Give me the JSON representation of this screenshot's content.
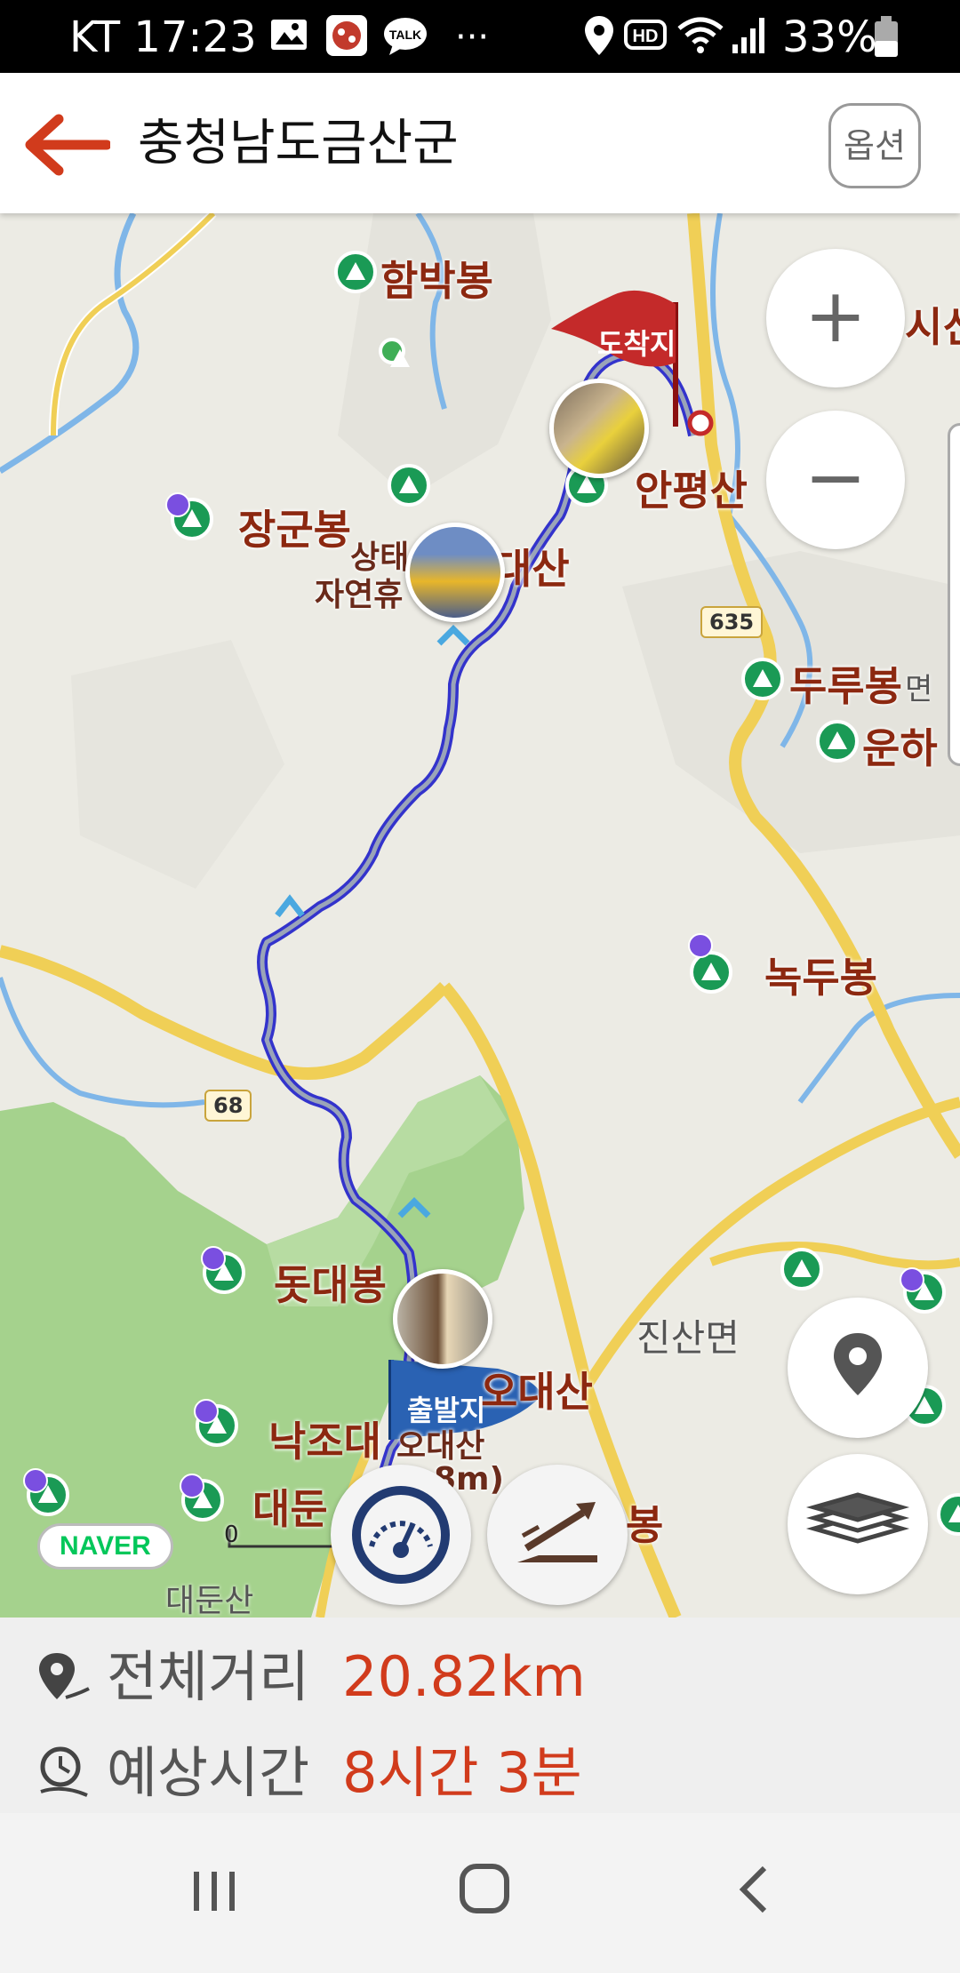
{
  "status_bar": {
    "carrier_time": "KT 17:23",
    "battery_percent": "33%",
    "talk_label": "TALK",
    "more": "···",
    "hd_label": "HD"
  },
  "header": {
    "title": "충청남도금산군",
    "option_label": "옵션"
  },
  "map": {
    "places": {
      "hambakbong": "함박봉",
      "ijin": "시신",
      "arrival": "도착지",
      "anpyeongsan": "안평산",
      "janggunbong": "장군봉",
      "daesan": "대산",
      "sangtae": "상태",
      "jayeonhyu": "자연휴",
      "durubong": "두루봉",
      "myeon": "면",
      "unha": "운하",
      "nokdubong": "녹두봉",
      "jinsanmyeon": "진산면",
      "dotdaebong": "돗대봉",
      "odaesan": "오대산",
      "departure": "출발지",
      "nakjodae": "낙조대",
      "odaesan_small": "오대산",
      "elev": "8m)",
      "daedun": "대둔",
      "bong": "봉",
      "daedunsan": "대둔산"
    },
    "road_numbers": [
      "635",
      "68"
    ],
    "scale_zero": "0",
    "naver_logo": "NAVER",
    "zoom_in": "+",
    "zoom_out": "−"
  },
  "info": {
    "distance_label": "전체거리",
    "distance_value": "20.82km",
    "time_label": "예상시간",
    "time_value": "8시간 3분"
  },
  "colors": {
    "accent_red": "#d13b1c",
    "route_blue": "#3333cc",
    "mountain_green": "#1a9a55",
    "place_text": "#8c2810"
  }
}
